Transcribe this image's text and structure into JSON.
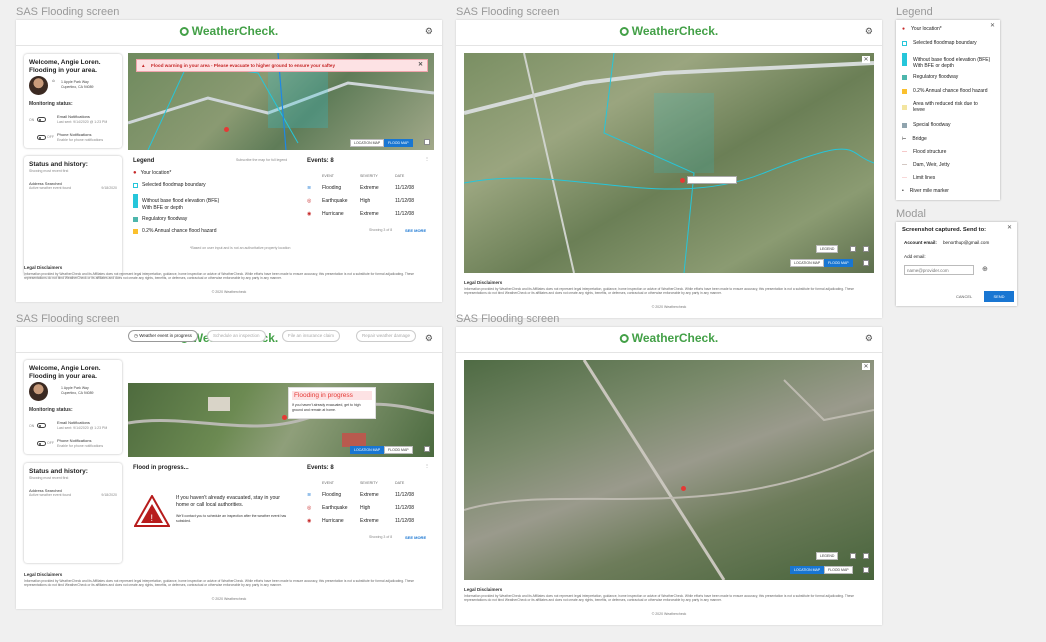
{
  "frame_title": "SAS Flooding screen",
  "panel_legend_title": "Legend",
  "panel_modal_title": "Modal",
  "logo": "WeatherCheck.",
  "welcome": "Welcome, Angie Loren. Flooding in your area.",
  "welcome_l1": "Welcome, Angie Loren.",
  "welcome_l2": "Flooding in your area.",
  "addr1": "1 Apple Park Way",
  "addr2": "Cupertino, CA 94089",
  "monitoring": "Monitoring status:",
  "on": "ON",
  "off": "OFF",
  "email_notif": "Email Notifications",
  "email_last": "Last sent: 9/14/2020 @ 1:23 PM",
  "phone_notif": "Phone Notifications",
  "phone_sub": "Enable for phone notifications",
  "status_history": "Status and history:",
  "showing_recent": "Showing most recent first",
  "addr_searched": "Address Searched",
  "addr_searched_sub": "Active weather event found",
  "addr_date": "9/18/2020",
  "alert": "Flood warning in your area - Please evacuate to higher ground to ensure your saftey",
  "location_map": "LOCATION MAP",
  "flood_map": "FLOOD MAP",
  "legend_btn": "LEGEND",
  "legend_title": "Legend",
  "legend_hint": "Subscribe the map for full legend",
  "legend_items": [
    "Your location*",
    "Selected floodmap boundary",
    "Without base flood elevation (BFE)",
    "With BFE or depth",
    "Regulatory floodway",
    "0.2% Annual chance flood hazard"
  ],
  "legend_foot": "*Based on user input and is not an authoritative property location",
  "events_title": "Events: 8",
  "ev_headers": [
    "EVENT",
    "SEVERITY",
    "DATE"
  ],
  "events": [
    {
      "name": "Flooding",
      "sev": "Extreme",
      "date": "11/12/08"
    },
    {
      "name": "Earthquake",
      "sev": "High",
      "date": "11/12/08"
    },
    {
      "name": "Hurricane",
      "sev": "Extreme",
      "date": "11/12/08"
    }
  ],
  "showing": "Showing 3 of 8",
  "see_more": "SEE MORE",
  "legal_title": "Legal Disclaimers",
  "legal_text": "Information provided by WeatherCheck and its Affiliates does not represent legal interpretation, guidance, home inspection or advice of WeatherCheck. While efforts have been made to ensure accuracy, this presentation is not a substitute for formal adjudicating. These representations do not bind WeatherCheck or its affiliates and does not create any rights, benefits, or defenses, contractual or otherwise enforceable by any party in any manner.",
  "copyright": "© 2020 Weathercheck",
  "steps": [
    "Weather event in progress",
    "Schedule an inspection",
    "File an insurance claim",
    "Repair weather damage"
  ],
  "flood_prog": "Flooding in progress",
  "flood_prog_sub": "If you haven't already evacuated, get to high ground and remain at home.",
  "flood_prog_card": "Flood in progress...",
  "stay_msg": "If you haven't already evacuated, stay in your home or call local authorities.",
  "contact_msg": "We'll contact you to schedule an inspection after the weather event has subsided.",
  "side_legend": [
    "Your location*",
    "Selected floodmap boundary",
    "Without base flood elevation (BFE)",
    "With BFE or depth",
    "Regulatory floodway",
    "0.2% Annual chance flood hazard",
    "Area with reduced risk due to levee",
    "Special floodway",
    "Bridge",
    "Flood structure",
    "Dam, Weir, Jetty",
    "Limit lines",
    "River mile marker"
  ],
  "modal": {
    "title": "Screenshot captured. Send to:",
    "acct_label": "Account email:",
    "acct": "benorthup@gmail.com",
    "add_label": "Add email:",
    "placeholder": "name@provider.com",
    "cancel": "CANCEL",
    "send": "SEND"
  },
  "colors": {
    "brand": "#43a047",
    "accent": "#1976d2",
    "alert_bg": "#fde2e4",
    "alert": "#c62828",
    "cyan": "#26c6da",
    "floodway": "#4db6ac",
    "hazard": "#fbc02d"
  }
}
